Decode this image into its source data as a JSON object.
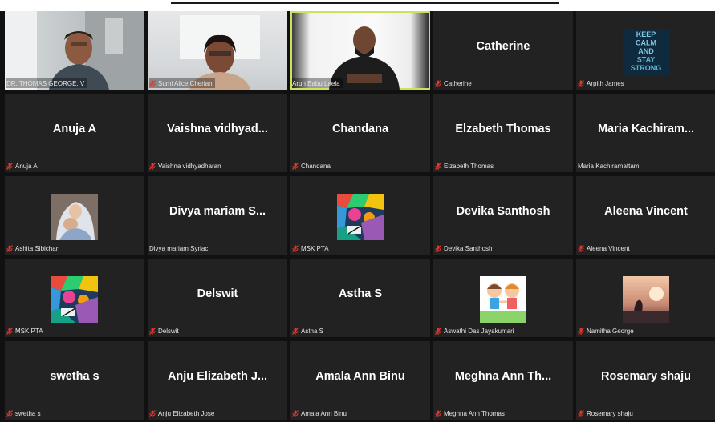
{
  "colors": {
    "mic_muted": "#e0362c",
    "active_border": "#c9e35a",
    "tile_bg": "#222222"
  },
  "participants": [
    {
      "display": "",
      "label": "DR. THOMAS GEORGE. V",
      "muted": false,
      "type": "video"
    },
    {
      "display": "",
      "label": "Sumi Alice Cherian",
      "muted": true,
      "type": "video"
    },
    {
      "display": "",
      "label": "Arun Babu Laela",
      "muted": false,
      "type": "video",
      "active": true
    },
    {
      "display": "Catherine",
      "label": "Catherine",
      "muted": true,
      "type": "name"
    },
    {
      "display": "",
      "label": "Arpith James",
      "muted": true,
      "type": "avatar",
      "avatar": "keep-calm",
      "avatar_text": [
        "KEEP",
        "CALM",
        "AND",
        "STAY",
        "STRONG"
      ]
    },
    {
      "display": "Anuja A",
      "label": "Anuja A",
      "muted": true,
      "type": "name"
    },
    {
      "display": "Vaishna vidhyad...",
      "label": "Vaishna vidhyadharan",
      "muted": true,
      "type": "name"
    },
    {
      "display": "Chandana",
      "label": "Chandana",
      "muted": true,
      "type": "name"
    },
    {
      "display": "Elzabeth Thomas",
      "label": "Elzabeth Thomas",
      "muted": true,
      "type": "name"
    },
    {
      "display": "Maria Kachiram...",
      "label": "Maria Kachirarnattam.",
      "muted": false,
      "type": "name"
    },
    {
      "display": "",
      "label": "Ashita Sibichan",
      "muted": true,
      "type": "avatar",
      "avatar": "mother-child"
    },
    {
      "display": "Divya mariam S...",
      "label": "Divya mariam Syriac",
      "muted": false,
      "type": "name"
    },
    {
      "display": "",
      "label": "MSK PTA",
      "muted": true,
      "type": "avatar",
      "avatar": "mosaic"
    },
    {
      "display": "Devika Santhosh",
      "label": "Devika Santhosh",
      "muted": true,
      "type": "name"
    },
    {
      "display": "Aleena Vincent",
      "label": "Aleena Vincent",
      "muted": true,
      "type": "name"
    },
    {
      "display": "",
      "label": "MSK PTA",
      "muted": true,
      "type": "avatar",
      "avatar": "mosaic"
    },
    {
      "display": "Delswit",
      "label": "Delswit",
      "muted": true,
      "type": "name"
    },
    {
      "display": "Astha S",
      "label": "Astha S",
      "muted": true,
      "type": "name"
    },
    {
      "display": "",
      "label": "Aswathi Das Jayakumari",
      "muted": true,
      "type": "avatar",
      "avatar": "kids"
    },
    {
      "display": "",
      "label": "Namitha George",
      "muted": true,
      "type": "avatar",
      "avatar": "sunset"
    },
    {
      "display": "swetha s",
      "label": "swetha s",
      "muted": true,
      "type": "name"
    },
    {
      "display": "Anju Elizabeth J...",
      "label": "Anju Elizabeth Jose",
      "muted": true,
      "type": "name"
    },
    {
      "display": "Amala Ann Binu",
      "label": "Amala Ann Binu",
      "muted": true,
      "type": "name"
    },
    {
      "display": "Meghna Ann Th...",
      "label": "Meghna Ann Thomas",
      "muted": true,
      "type": "name"
    },
    {
      "display": "Rosemary shaju",
      "label": "Rosemary shaju",
      "muted": true,
      "type": "name"
    }
  ]
}
